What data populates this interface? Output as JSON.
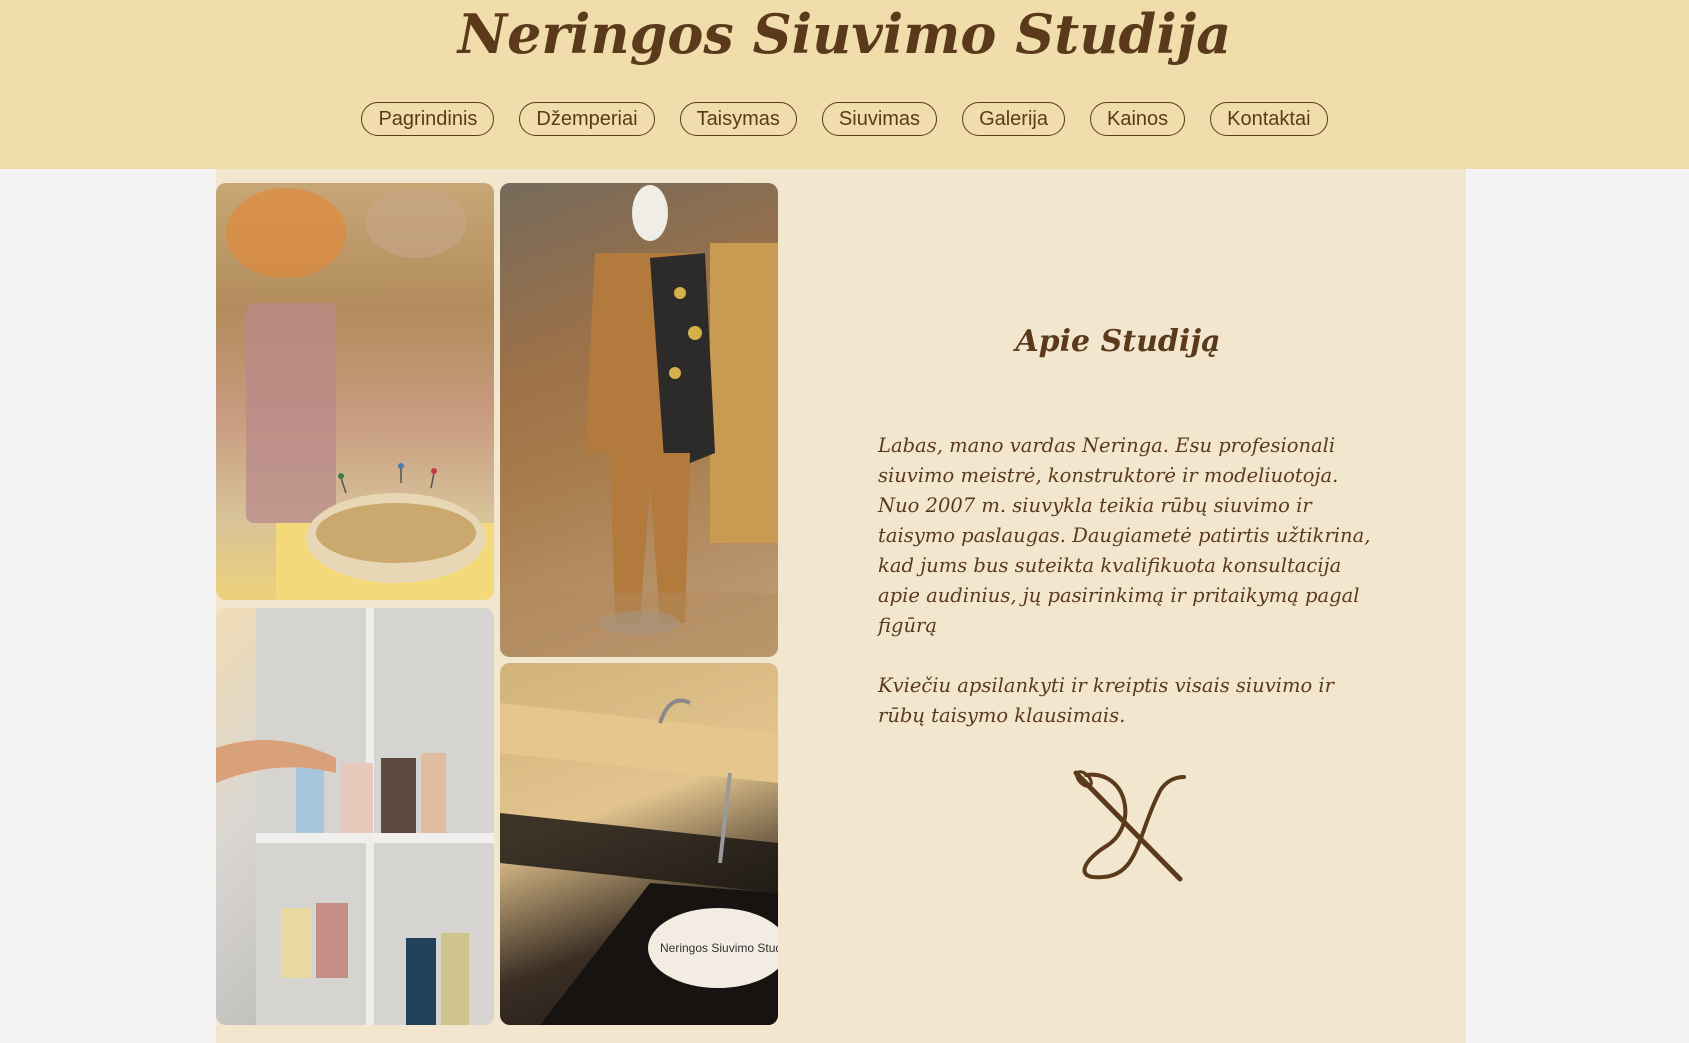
{
  "header": {
    "site_title": "Neringos Siuvimo Studija",
    "nav": [
      {
        "label": "Pagrindinis"
      },
      {
        "label": "Džemperiai"
      },
      {
        "label": "Taisymas"
      },
      {
        "label": "Siuvimas"
      },
      {
        "label": "Galerija"
      },
      {
        "label": "Kainos"
      },
      {
        "label": "Kontaktai"
      }
    ]
  },
  "gallery": {
    "hanger_tag_text": "Neringos Siuvimo Stud"
  },
  "about": {
    "title": "Apie Studiją",
    "paragraph_1": "Labas, mano vardas Neringa. Esu profesionali siuvimo meistrė, konstruktorė ir modeliuotoja. Nuo 2007 m. siuvykla teikia rūbų siuvimo ir taisymo paslaugas. Daugiametė patirtis užtikrina, kad jums bus suteikta kvalifikuota konsultacija apie audinius, jų pasirinkimą ir pritaikymą pagal figūrą",
    "paragraph_2": "Kviečiu apsilankyti ir kreiptis visais siuvimo ir rūbų taisymo klausimais.",
    "logo_icon": "needle-thread-icon"
  },
  "colors": {
    "header_bg": "#f1dcac",
    "content_bg": "#f2e6cf",
    "page_bg": "#f4f4f4",
    "brand_brown": "#5b3a1b"
  }
}
